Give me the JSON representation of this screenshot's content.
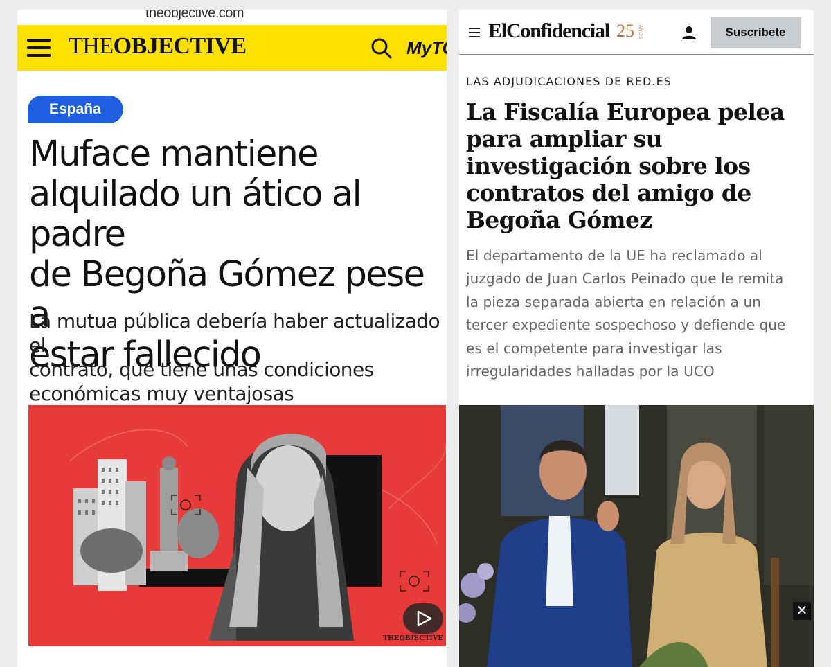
{
  "left": {
    "url_fragment": "theobjective.com",
    "brand": {
      "logo_part1": "THE",
      "logo_part2": "OBJECTIVE",
      "my_label": "MyTO",
      "color": "#ffe000"
    },
    "section_badge": "España",
    "headline": "Muface mantiene\nalquilado un ático al padre\nde Begoña Gómez pese a\nestar fallecido",
    "subheadline": "La mutua pública debería haber actualizado el\ncontrato, que tiene unas condiciones\neconómicas muy ventajosas",
    "image": {
      "watermark": "THEOBJECTIVE",
      "background": "#e63b38",
      "play_icon": "play-icon"
    }
  },
  "right": {
    "brand": {
      "logo": "ElConfidencial",
      "anniversary": "25",
      "anniversary_small": "AÑOS",
      "accent": "#b87340"
    },
    "subscribe_label": "Suscríbete",
    "kicker": "LAS ADJUDICACIONES DE RED.ES",
    "headline": "La Fiscalía Europea pelea\npara ampliar su\ninvestigación sobre los\ncontratos del amigo de\nBegoña Gómez",
    "lead": "El departamento de la UE ha reclamado al\njuzgado de Juan Carlos Peinado que le remita\nla pieza separada abierta en relación a un\ntercer expediente sospechoso y defiende que\nes el competente para investigar las\nirregularidades halladas por la UCO",
    "close_label": "✕"
  }
}
